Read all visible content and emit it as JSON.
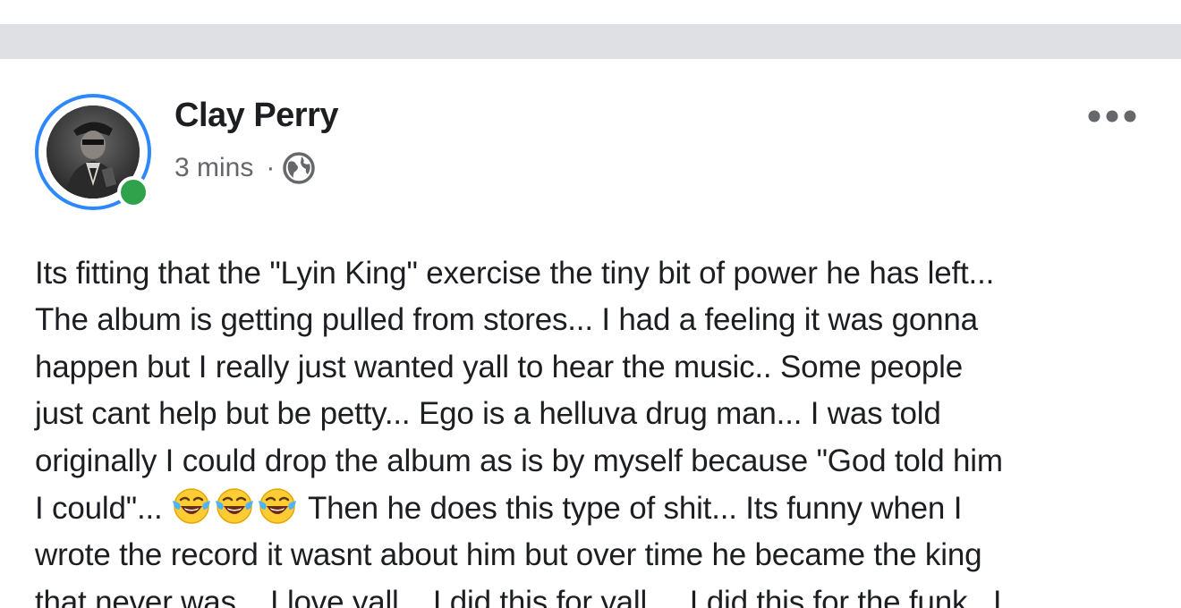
{
  "post": {
    "author": "Clay Perry",
    "timestamp": "3 mins",
    "separator": "·",
    "visibility_icon": "globe-icon",
    "more_icon": "more-horizontal-icon",
    "avatar_status": "online",
    "body_lines": [
      "Its fitting that the \"Lyin King\" exercise the tiny bit of power he has left...",
      "The album is getting pulled from stores... I had a feeling it was gonna",
      "happen but I really just wanted yall to hear the music.. Some people",
      "just cant help but be petty... Ego is a helluva drug man... I was told",
      "originally I could drop the album as is by myself because \"God told him",
      "I could\"...",
      "Then he does this type of shit... Its funny when I",
      "wrote the record it wasnt about him but over time he became the king",
      "that never was... I love yall... I did this for yall.... I did this for the funk.. I"
    ],
    "emoji_name": "laughing-crying-emoji",
    "emoji_count": 3
  },
  "colors": {
    "separator_bar": "#dfe0e4",
    "avatar_ring": "#2d88ff",
    "online": "#31a24c",
    "text_primary": "#1c1e21",
    "text_secondary": "#65676b"
  }
}
